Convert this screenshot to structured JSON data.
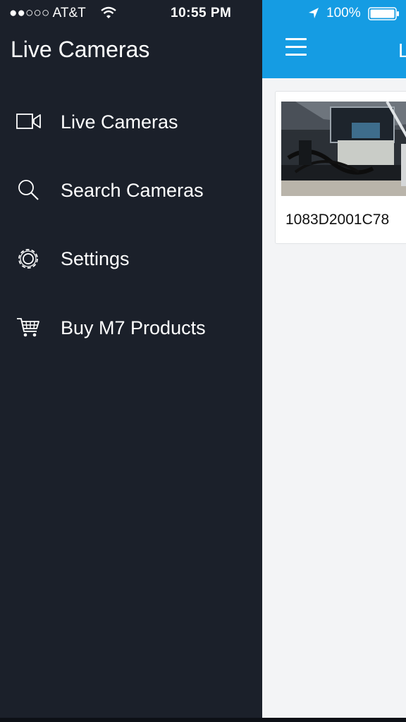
{
  "status_bar": {
    "carrier": "●●○○○ AT&T",
    "time": "10:55 PM",
    "battery": "100%"
  },
  "drawer": {
    "title": "Live Cameras",
    "menu": [
      {
        "label": "Live Cameras",
        "icon": "video-camera-icon"
      },
      {
        "label": "Search Cameras",
        "icon": "search-icon"
      },
      {
        "label": "Settings",
        "icon": "gear-icon"
      },
      {
        "label": "Buy M7 Products",
        "icon": "shopping-cart-icon"
      }
    ]
  },
  "main": {
    "title": "L",
    "cameras": [
      {
        "id": "1083D2001C78"
      }
    ]
  },
  "colors": {
    "drawer_bg": "#1b202a",
    "nav_bar": "#159ce3",
    "content_bg": "#f3f4f6"
  }
}
